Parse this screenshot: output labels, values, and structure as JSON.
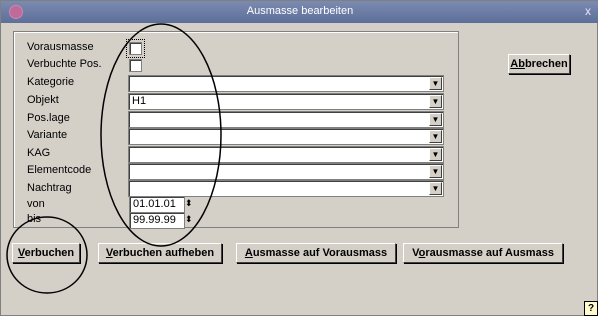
{
  "window": {
    "title": "Ausmasse bearbeiten",
    "close_glyph": "x"
  },
  "form": {
    "vorausmasse": {
      "label": "Vorausmasse",
      "checked": false
    },
    "verbuchte_pos": {
      "label": "Verbuchte Pos.",
      "checked": false
    },
    "kategorie": {
      "label": "Kategorie",
      "value": ""
    },
    "objekt": {
      "label": "Objekt",
      "value": "H1"
    },
    "pos_lage": {
      "label": "Pos.lage",
      "value": ""
    },
    "variante": {
      "label": "Variante",
      "value": ""
    },
    "kag": {
      "label": "KAG",
      "value": ""
    },
    "elementcode": {
      "label": "Elementcode",
      "value": ""
    },
    "nachtrag": {
      "label": "Nachtrag",
      "value": ""
    },
    "von": {
      "label": "von",
      "value": "01.01.01"
    },
    "bis": {
      "label": "bis",
      "value": "99.99.99"
    }
  },
  "buttons": {
    "abbrechen": {
      "mnemonic": "Ab",
      "rest": "brechen"
    },
    "verbuchen": {
      "mnemonic": "V",
      "rest": "erbuchen"
    },
    "verbuchen_aufheben": {
      "mnemonic": "V",
      "rest": "erbuchen aufheben"
    },
    "ausmasse_auf_vorausmass": {
      "mnemonic": "A",
      "rest": "usmasse auf Vorausmass"
    },
    "vorausmasse_auf_ausmass": {
      "before": "V",
      "mnemonic": "o",
      "rest": "rausmasse auf Ausmass"
    }
  },
  "help_glyph": "?",
  "spin_glyph": "⬍",
  "dropdown_glyph": "▼"
}
